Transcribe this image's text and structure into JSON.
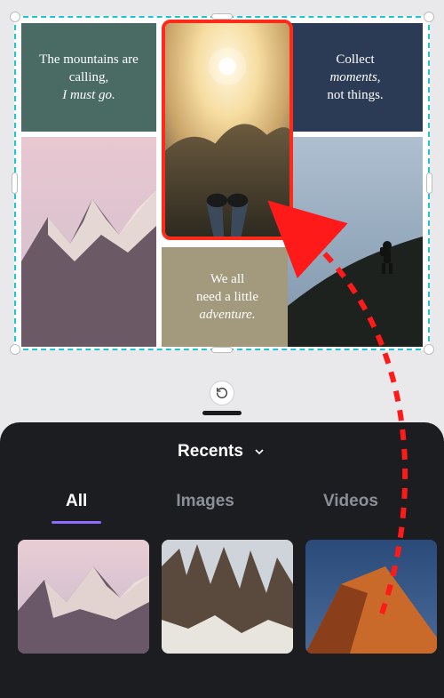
{
  "collage": {
    "mountains": {
      "line1": "The mountains are calling,",
      "line2": "I must go."
    },
    "collect": {
      "line1": "Collect",
      "line2_i": "moments",
      "line3": "not things."
    },
    "adventure": {
      "line1": "We all",
      "line2": "need a little",
      "line3_i": "adventure."
    }
  },
  "panel": {
    "title": "Recents",
    "tabs": {
      "all": "All",
      "images": "Images",
      "videos": "Videos"
    },
    "active_tab": "all"
  }
}
